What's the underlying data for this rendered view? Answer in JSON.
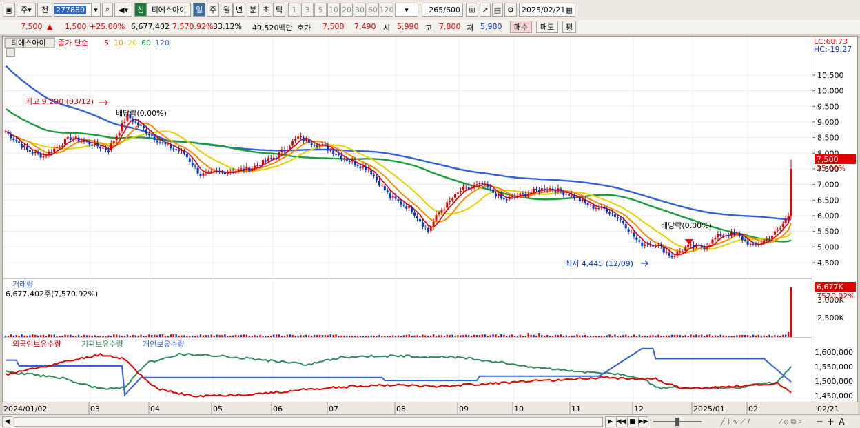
{
  "toolbar": {
    "period": "주",
    "prev": "전",
    "code": "277880",
    "badge": "신",
    "name": "티에스아이",
    "intervals": [
      "일",
      "주",
      "월",
      "년",
      "분",
      "초",
      "틱"
    ],
    "minutes": [
      "1",
      "3",
      "5",
      "10",
      "20",
      "30",
      "60",
      "120"
    ],
    "count": "265",
    "count_total": "/600",
    "date": "2025/02/21"
  },
  "quote": {
    "price": "7,500",
    "arrow": "▲",
    "change": "1,500",
    "change_pct": "+25.00%",
    "volume": "6,677,402",
    "volume_pct": "7,570.92%",
    "turnover": "33.12%",
    "amount": "49,520백만",
    "hoga_label": "호가",
    "ask": "7,500",
    "bid": "7,490",
    "open_label": "시",
    "open": "5,990",
    "high_label": "고",
    "high": "7,800",
    "low_label": "저",
    "low": "5,980",
    "buy": "매수",
    "sell": "매도",
    "eval": "평"
  },
  "price_panel": {
    "name_tag": "티에스아이",
    "legend_prefix": "종가 단순",
    "ma": [
      {
        "label": "5",
        "color": "#e00000"
      },
      {
        "label": "10",
        "color": "#ff8c00"
      },
      {
        "label": "20",
        "color": "#e6d000"
      },
      {
        "label": "60",
        "color": "#1a9c3a"
      },
      {
        "label": "120",
        "color": "#3060e0"
      }
    ],
    "high_note": "최고 9,290 (03/12)",
    "low_note": "최저 4,445 (12/09)",
    "div1": "배당락(0.00%)",
    "div2": "배당락(0.00%)",
    "lc": "LC:68.73",
    "hc": "HC:-19.27",
    "yticks": [
      "10,500",
      "10,000",
      "9,500",
      "9,000",
      "8,500",
      "8,000",
      "7,500",
      "7,000",
      "6,500",
      "6,000",
      "5,500",
      "5,000",
      "4,500"
    ],
    "last_price": "7,500",
    "last_pct": "25.00%"
  },
  "volume_panel": {
    "title": "거래량",
    "info": "6,677,402주(7,570.92%)",
    "last": "6,677K",
    "last_pct": "7570.92%",
    "yticks": [
      "3,000K",
      "2,500K"
    ]
  },
  "holding_panel": {
    "series": [
      {
        "label": "외국인보유수량",
        "color": "#e00000"
      },
      {
        "label": "기관보유수량",
        "color": "#2a8a5a"
      },
      {
        "label": "개인보유수량",
        "color": "#3060e0"
      }
    ],
    "yticks": [
      "1,600,000",
      "1,550,000",
      "1,500,000",
      "1,450,000"
    ]
  },
  "xaxis": {
    "labels": [
      "2024/01/02",
      "03",
      "04",
      "05",
      "06",
      "07",
      "08",
      "09",
      "10",
      "11",
      "12",
      "2025/01",
      "02"
    ],
    "right_label": "02/21"
  }
}
